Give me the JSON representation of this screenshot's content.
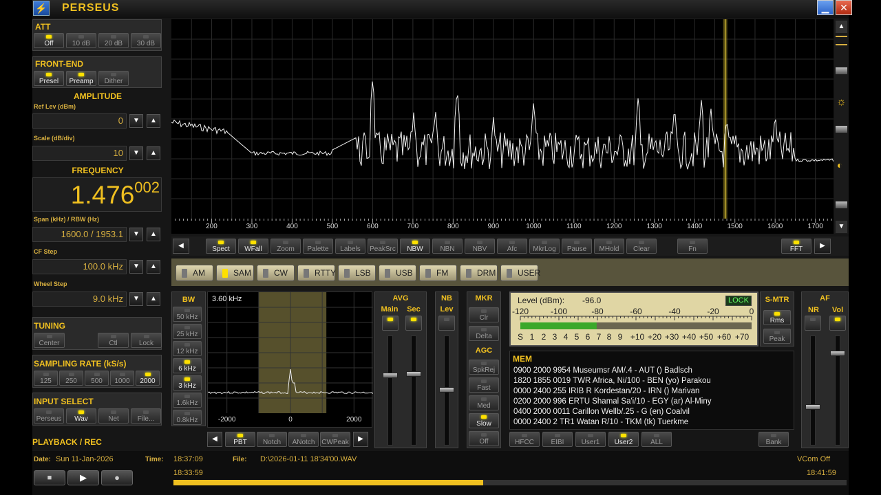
{
  "title_bar": {
    "app_title": "PERSEUS",
    "logo": "perseus-app-icon",
    "minimize_icon": "minimize-icon",
    "close_icon": "close-icon"
  },
  "left_panel": {
    "att": {
      "title": "ATT",
      "buttons": [
        "Off",
        "10 dB",
        "20 dB",
        "30 dB"
      ],
      "active": "Off"
    },
    "front_end": {
      "title": "FRONT-END",
      "buttons": [
        "Presel",
        "Preamp",
        "Dither"
      ],
      "active": [
        "Presel",
        "Preamp"
      ]
    },
    "amplitude": {
      "title": "AMPLITUDE",
      "ref_label": "Ref Lev (dBm)",
      "ref_value": "0",
      "scale_label": "Scale (dB/div)",
      "scale_value": "10"
    },
    "frequency": {
      "title": "FREQUENCY",
      "main": "1.476",
      "fine": "002"
    },
    "span": {
      "label": "Span (kHz) / RBW (Hz)",
      "value": "1600.0 / 1953.1"
    },
    "cf_step": {
      "label": "CF Step",
      "value": "100.0 kHz"
    },
    "wheel_step": {
      "label": "Wheel Step",
      "value": "9.0 kHz"
    },
    "tuning": {
      "title": "TUNING",
      "buttons": [
        "Center",
        "Ctl",
        "Lock"
      ]
    },
    "sampling": {
      "title": "SAMPLING RATE (kS/s)",
      "buttons": [
        "125",
        "250",
        "500",
        "1000",
        "2000"
      ],
      "active": "2000"
    },
    "input": {
      "title": "INPUT SELECT",
      "buttons": [
        "Perseus",
        "Wav",
        "Net",
        "File..."
      ],
      "active": "Wav"
    },
    "playback_title": "PLAYBACK / REC"
  },
  "spectrum": {
    "freq_ticks": [
      "200",
      "300",
      "400",
      "500",
      "600",
      "700",
      "800",
      "900",
      "1000",
      "1100",
      "1200",
      "1300",
      "1400",
      "1500",
      "1600",
      "1700"
    ],
    "marker_khz": 1476,
    "toolbar": [
      {
        "label": "Spect",
        "led": true
      },
      {
        "label": "WFall",
        "led": true
      },
      {
        "label": "Zoom",
        "led": false
      },
      {
        "label": "Palette",
        "led": false
      },
      {
        "label": "Labels",
        "led": false
      },
      {
        "label": "PeakSrc",
        "led": false
      },
      {
        "label": "NBW",
        "led": true
      },
      {
        "label": "NBN",
        "led": false
      },
      {
        "label": "NBV",
        "led": false
      },
      {
        "label": "Afc",
        "led": false
      },
      {
        "label": "MkrLog",
        "led": false
      },
      {
        "label": "Pause",
        "led": false
      },
      {
        "label": "MHold",
        "led": false
      },
      {
        "label": "Clear",
        "led": false
      },
      {
        "label": "Fn",
        "led": false
      },
      {
        "label": "FFT",
        "led": true
      }
    ]
  },
  "modes": {
    "items": [
      "AM",
      "SAM",
      "CW",
      "RTTY",
      "LSB",
      "USB",
      "FM",
      "DRM",
      "USER"
    ],
    "active": "SAM"
  },
  "bw": {
    "title": "BW",
    "buttons": [
      "50 kHz",
      "25 kHz",
      "12 kHz",
      "6 kHz",
      "3 kHz",
      "1.6kHz",
      "0.8kHz"
    ],
    "active": [
      "6 kHz",
      "3 kHz"
    ],
    "current": "3.60 kHz",
    "axis": [
      "-2000",
      "0",
      "2000"
    ]
  },
  "filter_buttons": [
    {
      "label": "PBT",
      "led": true
    },
    {
      "label": "Notch",
      "led": false
    },
    {
      "label": "ANotch",
      "led": false
    },
    {
      "label": "CWPeak",
      "led": false
    }
  ],
  "avg": {
    "title": "AVG",
    "main": "Main",
    "sec": "Sec"
  },
  "nb": {
    "title": "NB",
    "lev": "Lev"
  },
  "mkr": {
    "title": "MKR",
    "clr": "Clr",
    "delta": "Delta"
  },
  "agc": {
    "title": "AGC",
    "buttons": [
      "SpkRej",
      "Fast",
      "Med",
      "Slow",
      "Off"
    ],
    "active": "Slow"
  },
  "level": {
    "label": "Level (dBm):",
    "value": "-96.0",
    "lock": "LOCK",
    "dbm_scale": [
      "-120",
      "-100",
      "-80",
      "-60",
      "-40",
      "-20",
      "0"
    ],
    "s_scale": [
      "S",
      "1",
      "2",
      "3",
      "4",
      "5",
      "6",
      "7",
      "8",
      "9",
      "+10",
      "+20",
      "+30",
      "+40",
      "+50",
      "+60",
      "+70"
    ],
    "bar_fraction": 0.33
  },
  "smtr": {
    "title": "S-MTR",
    "rms": "Rms",
    "peak": "Peak"
  },
  "af": {
    "title": "AF",
    "nr": "NR",
    "vol": "Vol"
  },
  "mem": {
    "title": "MEM",
    "lines": [
      "0900 2000 9954 Museumsr AM/.4  - AUT ()   Badlsch",
      "1820 1855 0019 TWR Africa, Ni/100  - BEN (yo)   Parakou",
      "0000 2400 255 IRIB R Kordestan/20  - IRN ()   Marivan",
      "0200 2000 996 ERTU Shamal Sa'i/10  - EGY (ar)   Al-Miny",
      "0400 2000 0011 Carillon Wellb/.25  - G (en)   Coalvil",
      "0000 2400 2 TR1 Watan R/10  - TKM (tk)   Tuerkme"
    ],
    "buttons": [
      "HFCC",
      "EIBI",
      "User1",
      "User2",
      "ALL"
    ],
    "bank": "Bank"
  },
  "status": {
    "date_label": "Date:",
    "date": "Sun 11-Jan-2026",
    "time_label": "Time:",
    "time": "18:37:09",
    "file_label": "File:",
    "file": "D:\\2026-01-11 18'34'00.WAV",
    "vcom": "VCom Off",
    "start": "18:33:59",
    "end": "18:41:59",
    "progress": 0.46
  }
}
